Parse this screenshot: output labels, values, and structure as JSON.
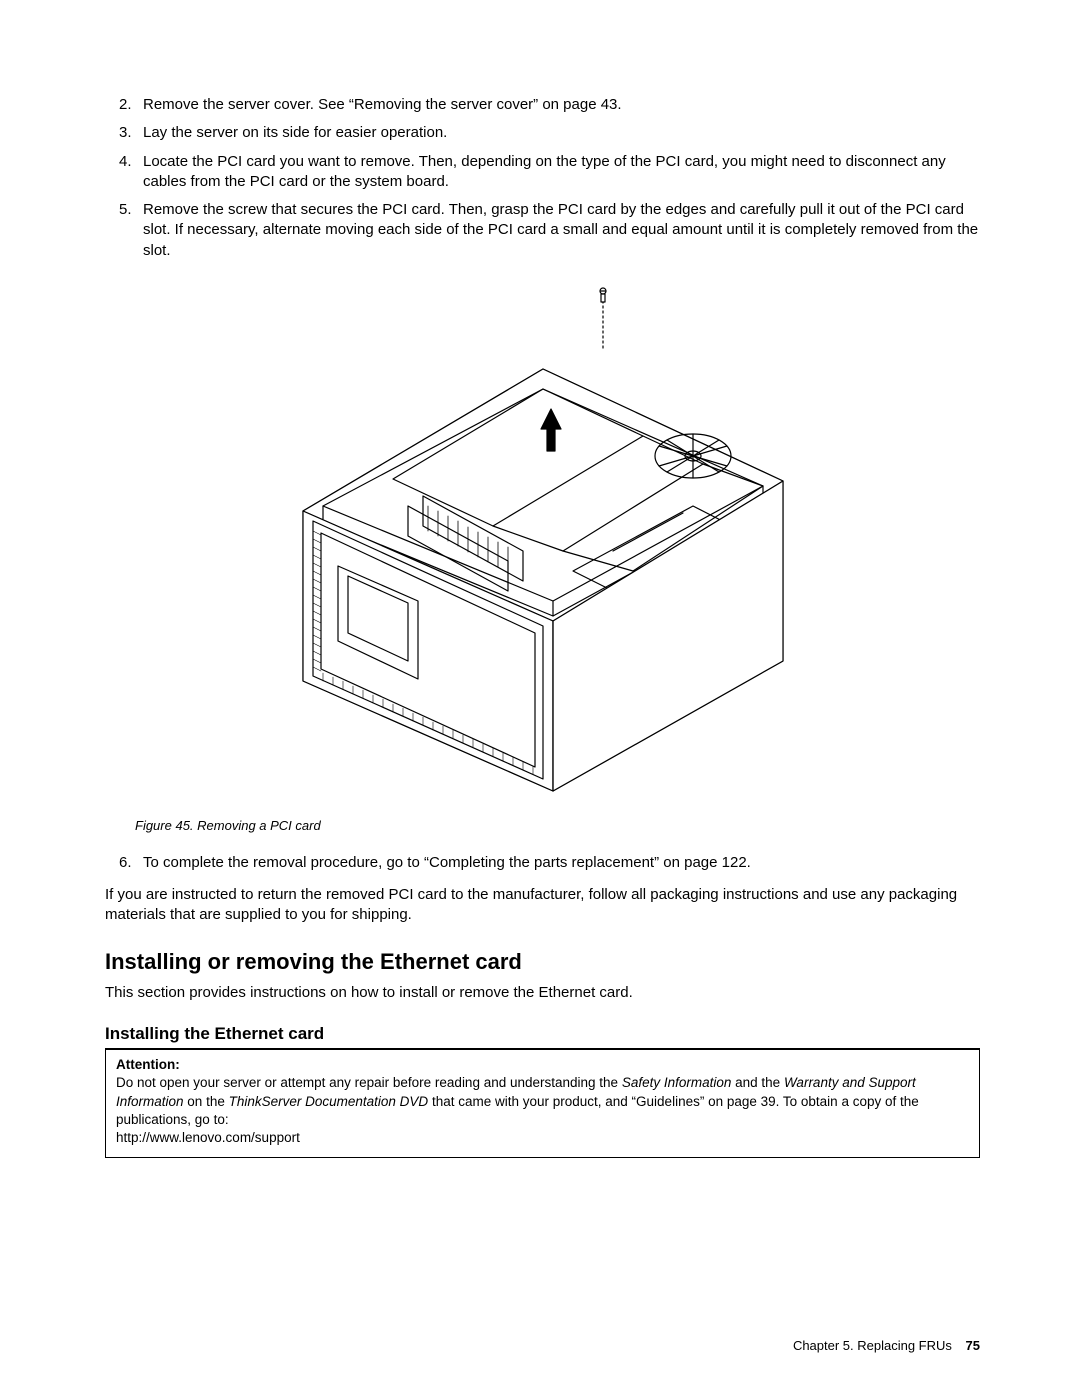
{
  "steps_a": [
    {
      "n": "2.",
      "text": "Remove the server cover. See “Removing the server cover” on page 43."
    },
    {
      "n": "3.",
      "text": "Lay the server on its side for easier operation."
    },
    {
      "n": "4.",
      "text": "Locate the PCI card you want to remove. Then, depending on the type of the PCI card, you might need to disconnect any cables from the PCI card or the system board."
    },
    {
      "n": "5.",
      "text": "Remove the screw that secures the PCI card. Then, grasp the PCI card by the edges and carefully pull it out of the PCI card slot. If necessary, alternate moving each side of the PCI card a small and equal amount until it is completely removed from the slot."
    }
  ],
  "figure_caption": "Figure 45.  Removing a PCI card",
  "step6": {
    "n": "6.",
    "text": "To complete the removal procedure, go to “Completing the parts replacement” on page 122."
  },
  "return_para": "If you are instructed to return the removed PCI card to the manufacturer, follow all packaging instructions and use any packaging materials that are supplied to you for shipping.",
  "h2": "Installing or removing the Ethernet card",
  "h2_desc": "This section provides instructions on how to install or remove the Ethernet card.",
  "h3": "Installing the Ethernet card",
  "attention": {
    "label": "Attention:",
    "pre": "Do not open your server or attempt any repair before reading and understanding the ",
    "it1": "Safety Information",
    "mid1": " and the ",
    "it2": "Warranty and Support Information",
    "mid2": " on the ",
    "it3": "ThinkServer Documentation DVD",
    "post": " that came with your product, and “Guidelines” on page 39. To obtain a copy of the publications, go to:",
    "url": "http://www.lenovo.com/support"
  },
  "footer": {
    "chapter": "Chapter 5.  Replacing FRUs",
    "page": "75"
  }
}
